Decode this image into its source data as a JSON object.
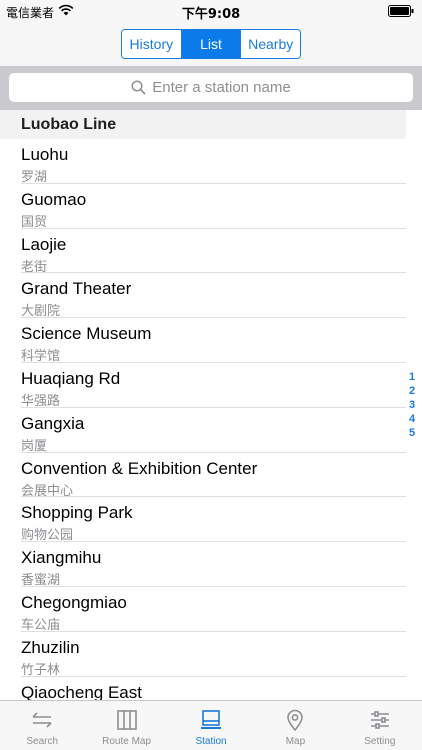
{
  "status_bar": {
    "carrier": "電信業者",
    "time": "下午9:08"
  },
  "nav": {
    "segments": [
      {
        "label": "History",
        "active": false
      },
      {
        "label": "List",
        "active": true
      },
      {
        "label": "Nearby",
        "active": false
      }
    ]
  },
  "search": {
    "placeholder": "Enter a station name",
    "icon": "search-icon"
  },
  "list": {
    "section_title": "Luobao Line",
    "stations": [
      {
        "en": "Luohu",
        "cn": "罗湖"
      },
      {
        "en": "Guomao",
        "cn": "国贸"
      },
      {
        "en": "Laojie",
        "cn": "老街"
      },
      {
        "en": "Grand Theater",
        "cn": "大剧院"
      },
      {
        "en": "Science Museum",
        "cn": "科学馆"
      },
      {
        "en": "Huaqiang Rd",
        "cn": "华强路"
      },
      {
        "en": "Gangxia",
        "cn": "岗厦"
      },
      {
        "en": "Convention & Exhibition Center",
        "cn": "会展中心"
      },
      {
        "en": "Shopping Park",
        "cn": "购物公园"
      },
      {
        "en": "Xiangmihu",
        "cn": "香蜜湖"
      },
      {
        "en": "Chegongmiao",
        "cn": "车公庙"
      },
      {
        "en": "Zhuzilin",
        "cn": "竹子林"
      },
      {
        "en": "Qiaocheng East",
        "cn": ""
      }
    ]
  },
  "index_bar": [
    "1",
    "2",
    "3",
    "4",
    "5"
  ],
  "tab_bar": {
    "tabs": [
      {
        "label": "Search",
        "icon": "swap-arrows-icon",
        "active": false
      },
      {
        "label": "Route Map",
        "icon": "map-book-icon",
        "active": false
      },
      {
        "label": "Station",
        "icon": "station-list-icon",
        "active": true
      },
      {
        "label": "Map",
        "icon": "location-pin-icon",
        "active": false
      },
      {
        "label": "Setting",
        "icon": "sliders-icon",
        "active": false
      }
    ]
  },
  "colors": {
    "accent": "#1a7ae0",
    "secondary_text": "#8e8e93",
    "section_bg": "#f2f2f2"
  }
}
